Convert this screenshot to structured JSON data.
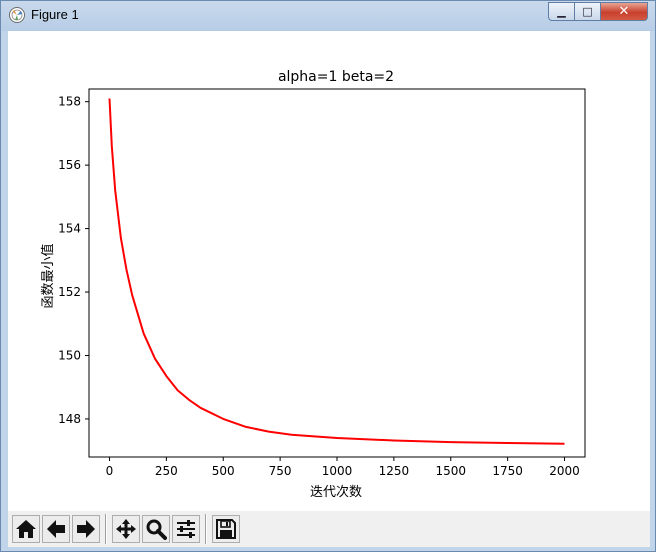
{
  "window": {
    "title": "Figure 1",
    "controls": {
      "minimize": "▁",
      "maximize": "□",
      "close": "✕"
    }
  },
  "toolbar": {
    "buttons": [
      {
        "name": "home-button",
        "icon": "home-icon"
      },
      {
        "name": "back-button",
        "icon": "arrow-left-icon"
      },
      {
        "name": "forward-button",
        "icon": "arrow-right-icon"
      },
      {
        "name": "pan-button",
        "icon": "move-icon"
      },
      {
        "name": "zoom-button",
        "icon": "magnifier-icon"
      },
      {
        "name": "subplots-button",
        "icon": "sliders-icon"
      },
      {
        "name": "save-button",
        "icon": "floppy-disk-icon"
      }
    ]
  },
  "chart_data": {
    "type": "line",
    "title": "alpha=1  beta=2",
    "xlabel": "迭代次数",
    "ylabel": "函数最小值",
    "xlim": [
      -90,
      2090
    ],
    "ylim": [
      146.8,
      158.4
    ],
    "xticks": [
      0,
      250,
      500,
      750,
      1000,
      1250,
      1500,
      1750,
      2000
    ],
    "yticks": [
      148,
      150,
      152,
      154,
      156,
      158
    ],
    "grid": false,
    "series": [
      {
        "color": "#ff0000",
        "x": [
          0,
          10,
          25,
          50,
          75,
          100,
          150,
          200,
          250,
          300,
          350,
          400,
          500,
          600,
          700,
          800,
          900,
          1000,
          1250,
          1500,
          1750,
          2000
        ],
        "y": [
          158.1,
          156.6,
          155.2,
          153.7,
          152.7,
          151.9,
          150.7,
          149.9,
          149.35,
          148.9,
          148.6,
          148.35,
          148.0,
          147.75,
          147.6,
          147.5,
          147.45,
          147.4,
          147.32,
          147.27,
          147.24,
          147.22
        ]
      }
    ]
  }
}
